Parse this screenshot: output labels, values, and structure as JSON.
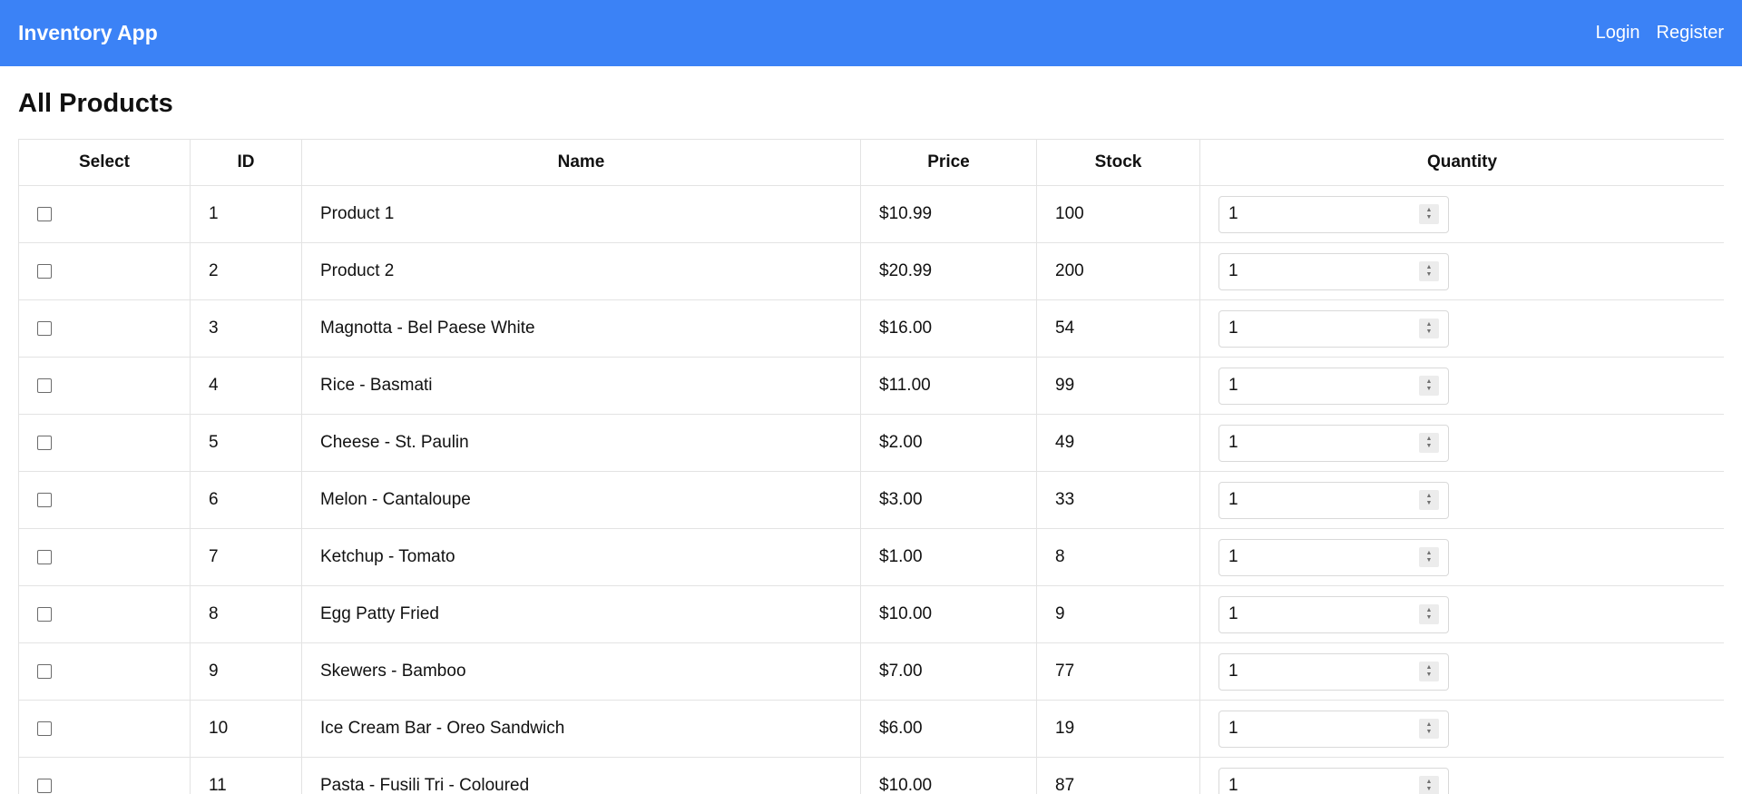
{
  "navbar": {
    "brand": "Inventory App",
    "links": [
      "Login",
      "Register"
    ]
  },
  "page": {
    "title": "All Products"
  },
  "table": {
    "columns": [
      "Select",
      "ID",
      "Name",
      "Price",
      "Stock",
      "Quantity"
    ],
    "rows": [
      {
        "id": "1",
        "name": "Product 1",
        "price": "$10.99",
        "stock": "100",
        "quantity": "1"
      },
      {
        "id": "2",
        "name": "Product 2",
        "price": "$20.99",
        "stock": "200",
        "quantity": "1"
      },
      {
        "id": "3",
        "name": "Magnotta - Bel Paese White",
        "price": "$16.00",
        "stock": "54",
        "quantity": "1"
      },
      {
        "id": "4",
        "name": "Rice - Basmati",
        "price": "$11.00",
        "stock": "99",
        "quantity": "1"
      },
      {
        "id": "5",
        "name": "Cheese - St. Paulin",
        "price": "$2.00",
        "stock": "49",
        "quantity": "1"
      },
      {
        "id": "6",
        "name": "Melon - Cantaloupe",
        "price": "$3.00",
        "stock": "33",
        "quantity": "1"
      },
      {
        "id": "7",
        "name": "Ketchup - Tomato",
        "price": "$1.00",
        "stock": "8",
        "quantity": "1"
      },
      {
        "id": "8",
        "name": "Egg Patty Fried",
        "price": "$10.00",
        "stock": "9",
        "quantity": "1"
      },
      {
        "id": "9",
        "name": "Skewers - Bamboo",
        "price": "$7.00",
        "stock": "77",
        "quantity": "1"
      },
      {
        "id": "10",
        "name": "Ice Cream Bar - Oreo Sandwich",
        "price": "$6.00",
        "stock": "19",
        "quantity": "1"
      },
      {
        "id": "11",
        "name": "Pasta - Fusili Tri - Coloured",
        "price": "$10.00",
        "stock": "87",
        "quantity": "1"
      }
    ]
  },
  "icons": {
    "checkbox": "checkbox-icon",
    "spinner": "spinner-arrows-icon"
  },
  "colors": {
    "navbar": "#3b82f6",
    "border": "#e3e3e3"
  }
}
